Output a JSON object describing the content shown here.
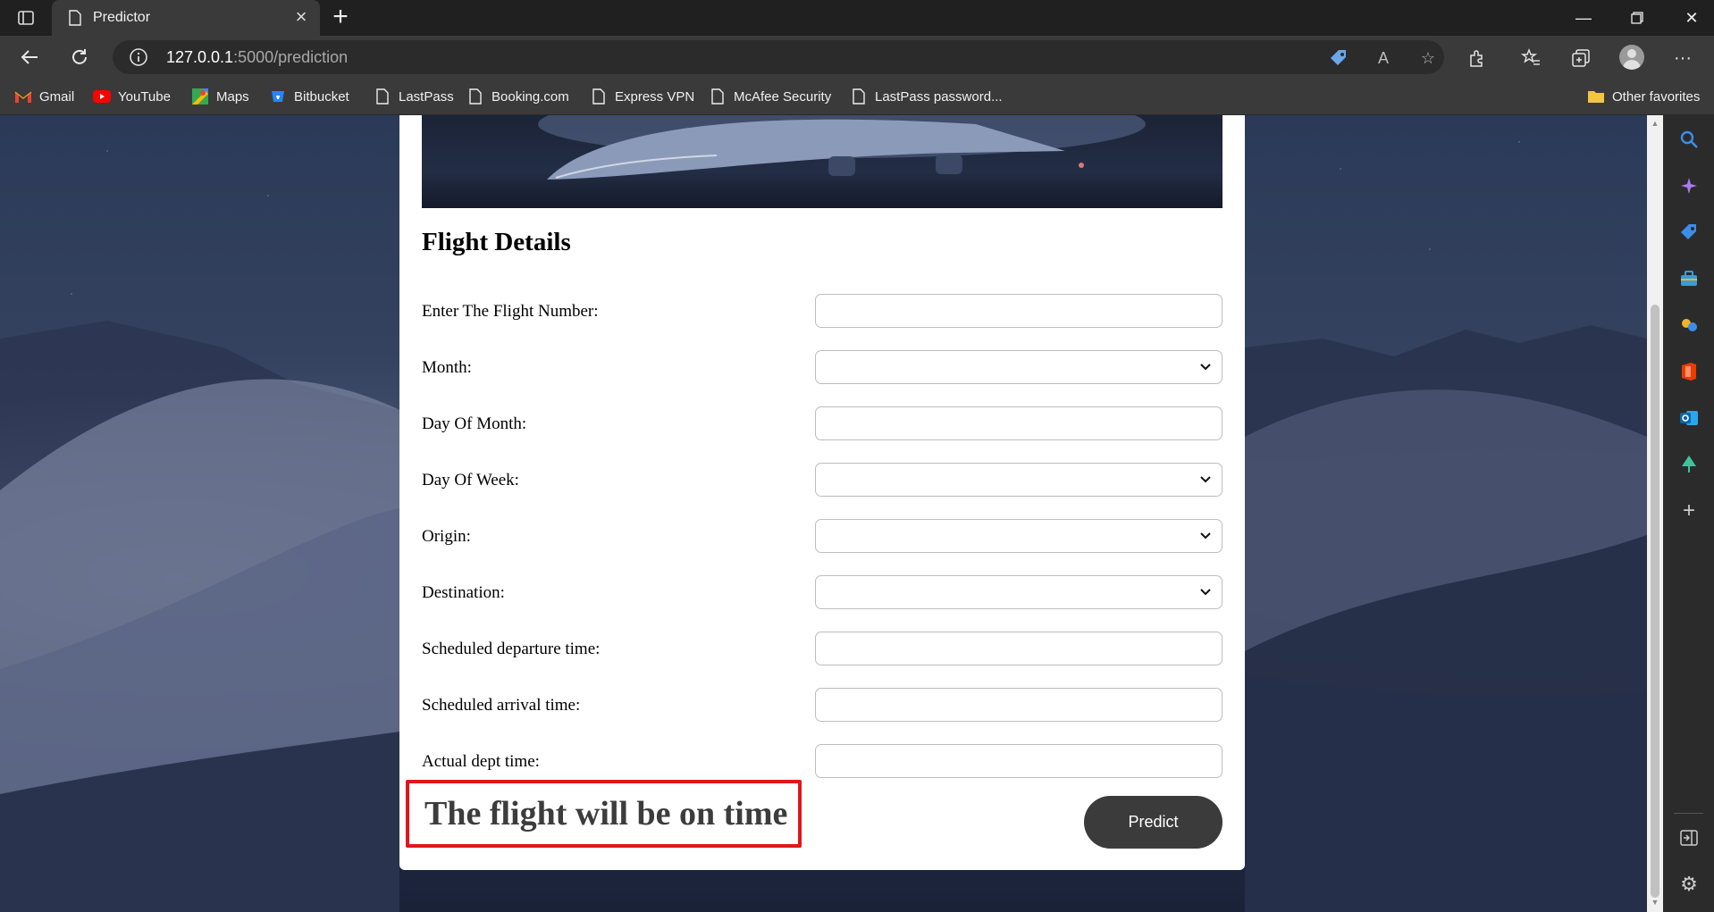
{
  "browser": {
    "tab_title": "Predictor",
    "new_tab_symbol": "+",
    "url_host": "127.0.0.1",
    "url_path": ":5000/prediction"
  },
  "bookmarks": [
    {
      "label": "Gmail",
      "icon": "gmail-icon"
    },
    {
      "label": "YouTube",
      "icon": "youtube-icon"
    },
    {
      "label": "Maps",
      "icon": "maps-icon"
    },
    {
      "label": "Bitbucket",
      "icon": "bitbucket-icon"
    },
    {
      "label": "LastPass",
      "icon": "page-icon"
    },
    {
      "label": "Booking.com",
      "icon": "page-icon"
    },
    {
      "label": "Express VPN",
      "icon": "page-icon"
    },
    {
      "label": "McAfee Security",
      "icon": "page-icon"
    },
    {
      "label": "LastPass password...",
      "icon": "page-icon"
    }
  ],
  "other_favorites": "Other favorites",
  "form": {
    "heading": "Flight Details",
    "fields": [
      {
        "label": "Enter The Flight Number:",
        "type": "text",
        "value": ""
      },
      {
        "label": "Month:",
        "type": "select",
        "value": ""
      },
      {
        "label": "Day Of Month:",
        "type": "text",
        "value": ""
      },
      {
        "label": "Day Of Week:",
        "type": "select",
        "value": ""
      },
      {
        "label": "Origin:",
        "type": "select",
        "value": ""
      },
      {
        "label": "Destination:",
        "type": "select",
        "value": ""
      },
      {
        "label": "Scheduled departure time:",
        "type": "text",
        "value": ""
      },
      {
        "label": "Scheduled arrival time:",
        "type": "text",
        "value": ""
      },
      {
        "label": "Actual dept time:",
        "type": "text",
        "value": ""
      }
    ],
    "result": "The flight will be on time",
    "predict_label": "Predict"
  },
  "colors": {
    "highlight": "#e0161c",
    "button": "#3b3b3b"
  }
}
